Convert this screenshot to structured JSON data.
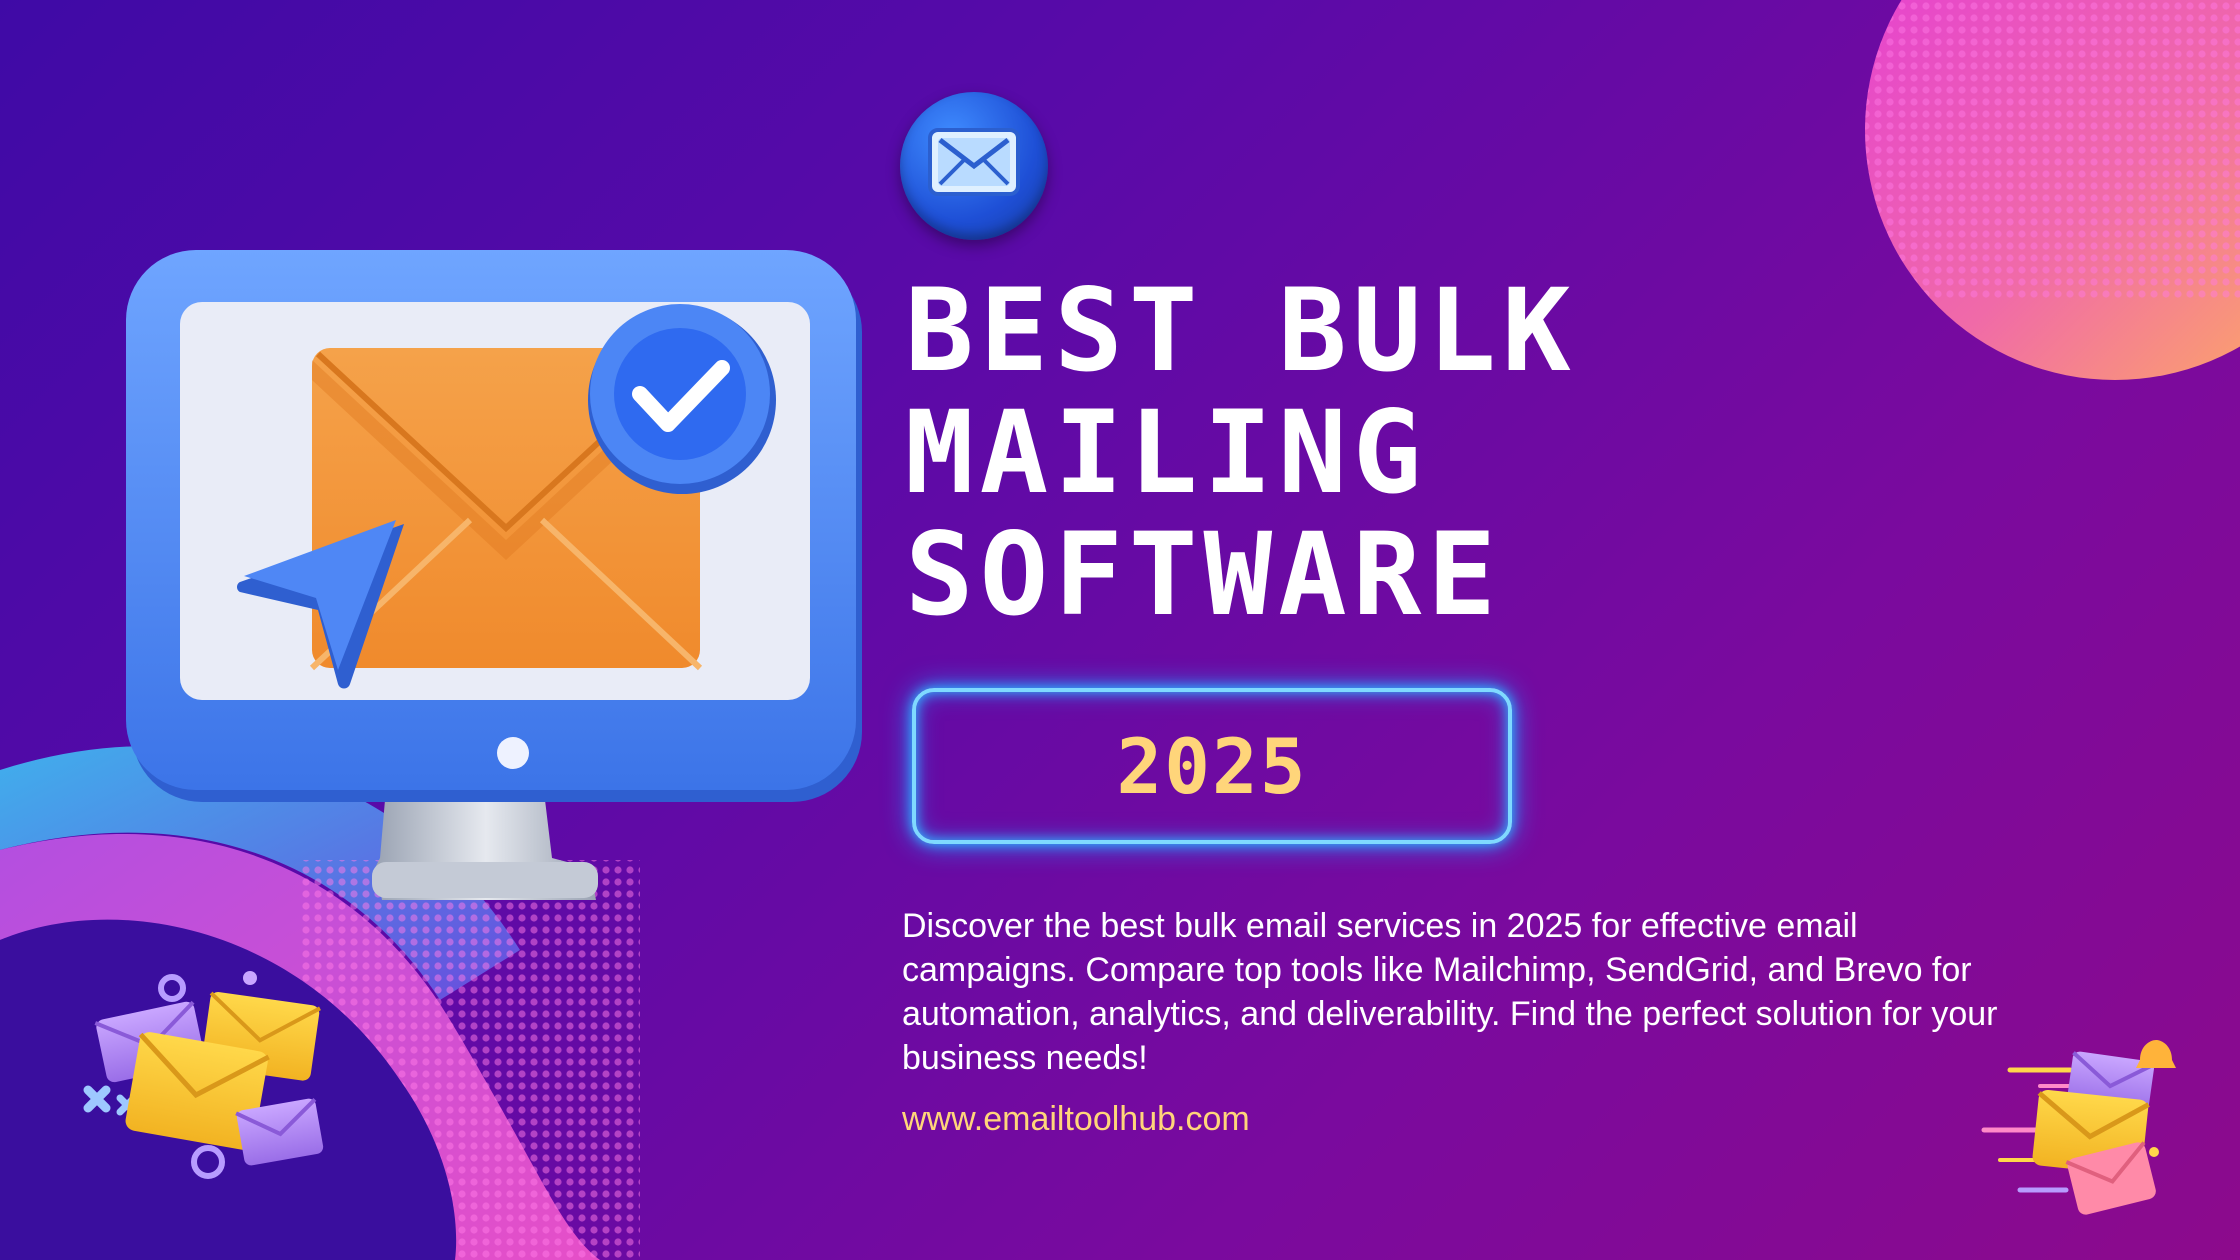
{
  "badge": {
    "icon": "envelope-icon"
  },
  "headline": {
    "line1": "BEST BULK",
    "line2": "MAILING",
    "line3": "SOFTWARE"
  },
  "year": "2025",
  "description": "Discover the best bulk email services in 2025 for effective email campaigns. Compare top tools like Mailchimp, SendGrid, and Brevo for automation, analytics, and deliverability. Find the perfect solution for your business needs!",
  "website": "www.emailtoolhub.com",
  "colors": {
    "accent_yellow": "#ffd57a",
    "neon_blue": "#7fd9ff",
    "background_start": "#3f0aa6",
    "background_end": "#8c0a8c"
  },
  "illustrations": [
    "monitor-with-envelope",
    "check-badge-icon",
    "cursor-arrow-icon",
    "envelopes-pile",
    "flying-envelopes",
    "halftone-circle"
  ]
}
